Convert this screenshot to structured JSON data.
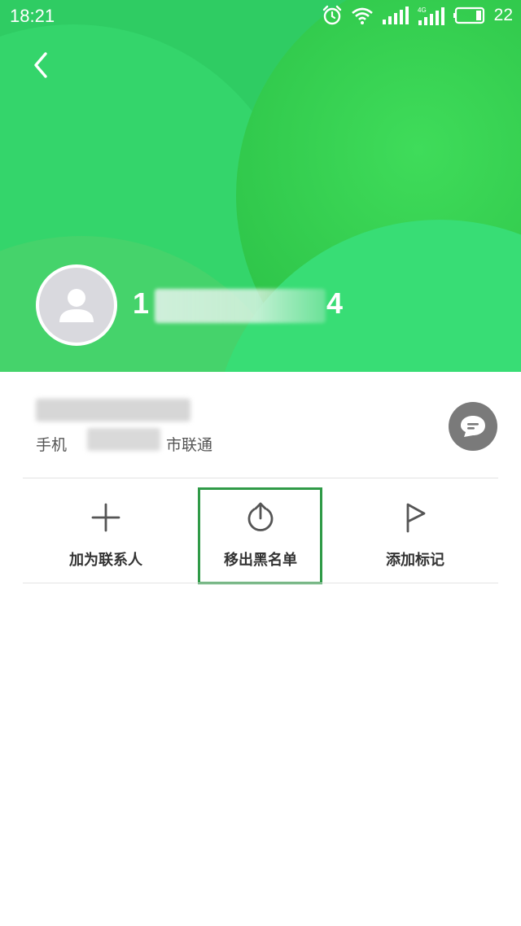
{
  "status_bar": {
    "time": "18:21",
    "battery_level": "22",
    "icons": [
      "alarm-icon",
      "wifi-icon",
      "signal-icon",
      "signal-4g-icon",
      "battery-icon"
    ],
    "network_badge": "4G"
  },
  "header": {
    "back_icon": "chevron-left-icon",
    "colors": {
      "primary": "#2fcc63",
      "dark": "#1eb03b"
    }
  },
  "profile": {
    "number_visible": "1",
    "number_tail": "4"
  },
  "info": {
    "phone_label": "手机",
    "carrier": "联通",
    "carrier_prefix": "市",
    "message_icon": "message-icon"
  },
  "actions": [
    {
      "label": "加为联系人",
      "icon": "plus-icon"
    },
    {
      "label": "移出黑名单",
      "icon": "unblock-icon"
    },
    {
      "label": "添加标记",
      "icon": "flag-icon"
    }
  ],
  "highlight_color": "#2f9a47"
}
